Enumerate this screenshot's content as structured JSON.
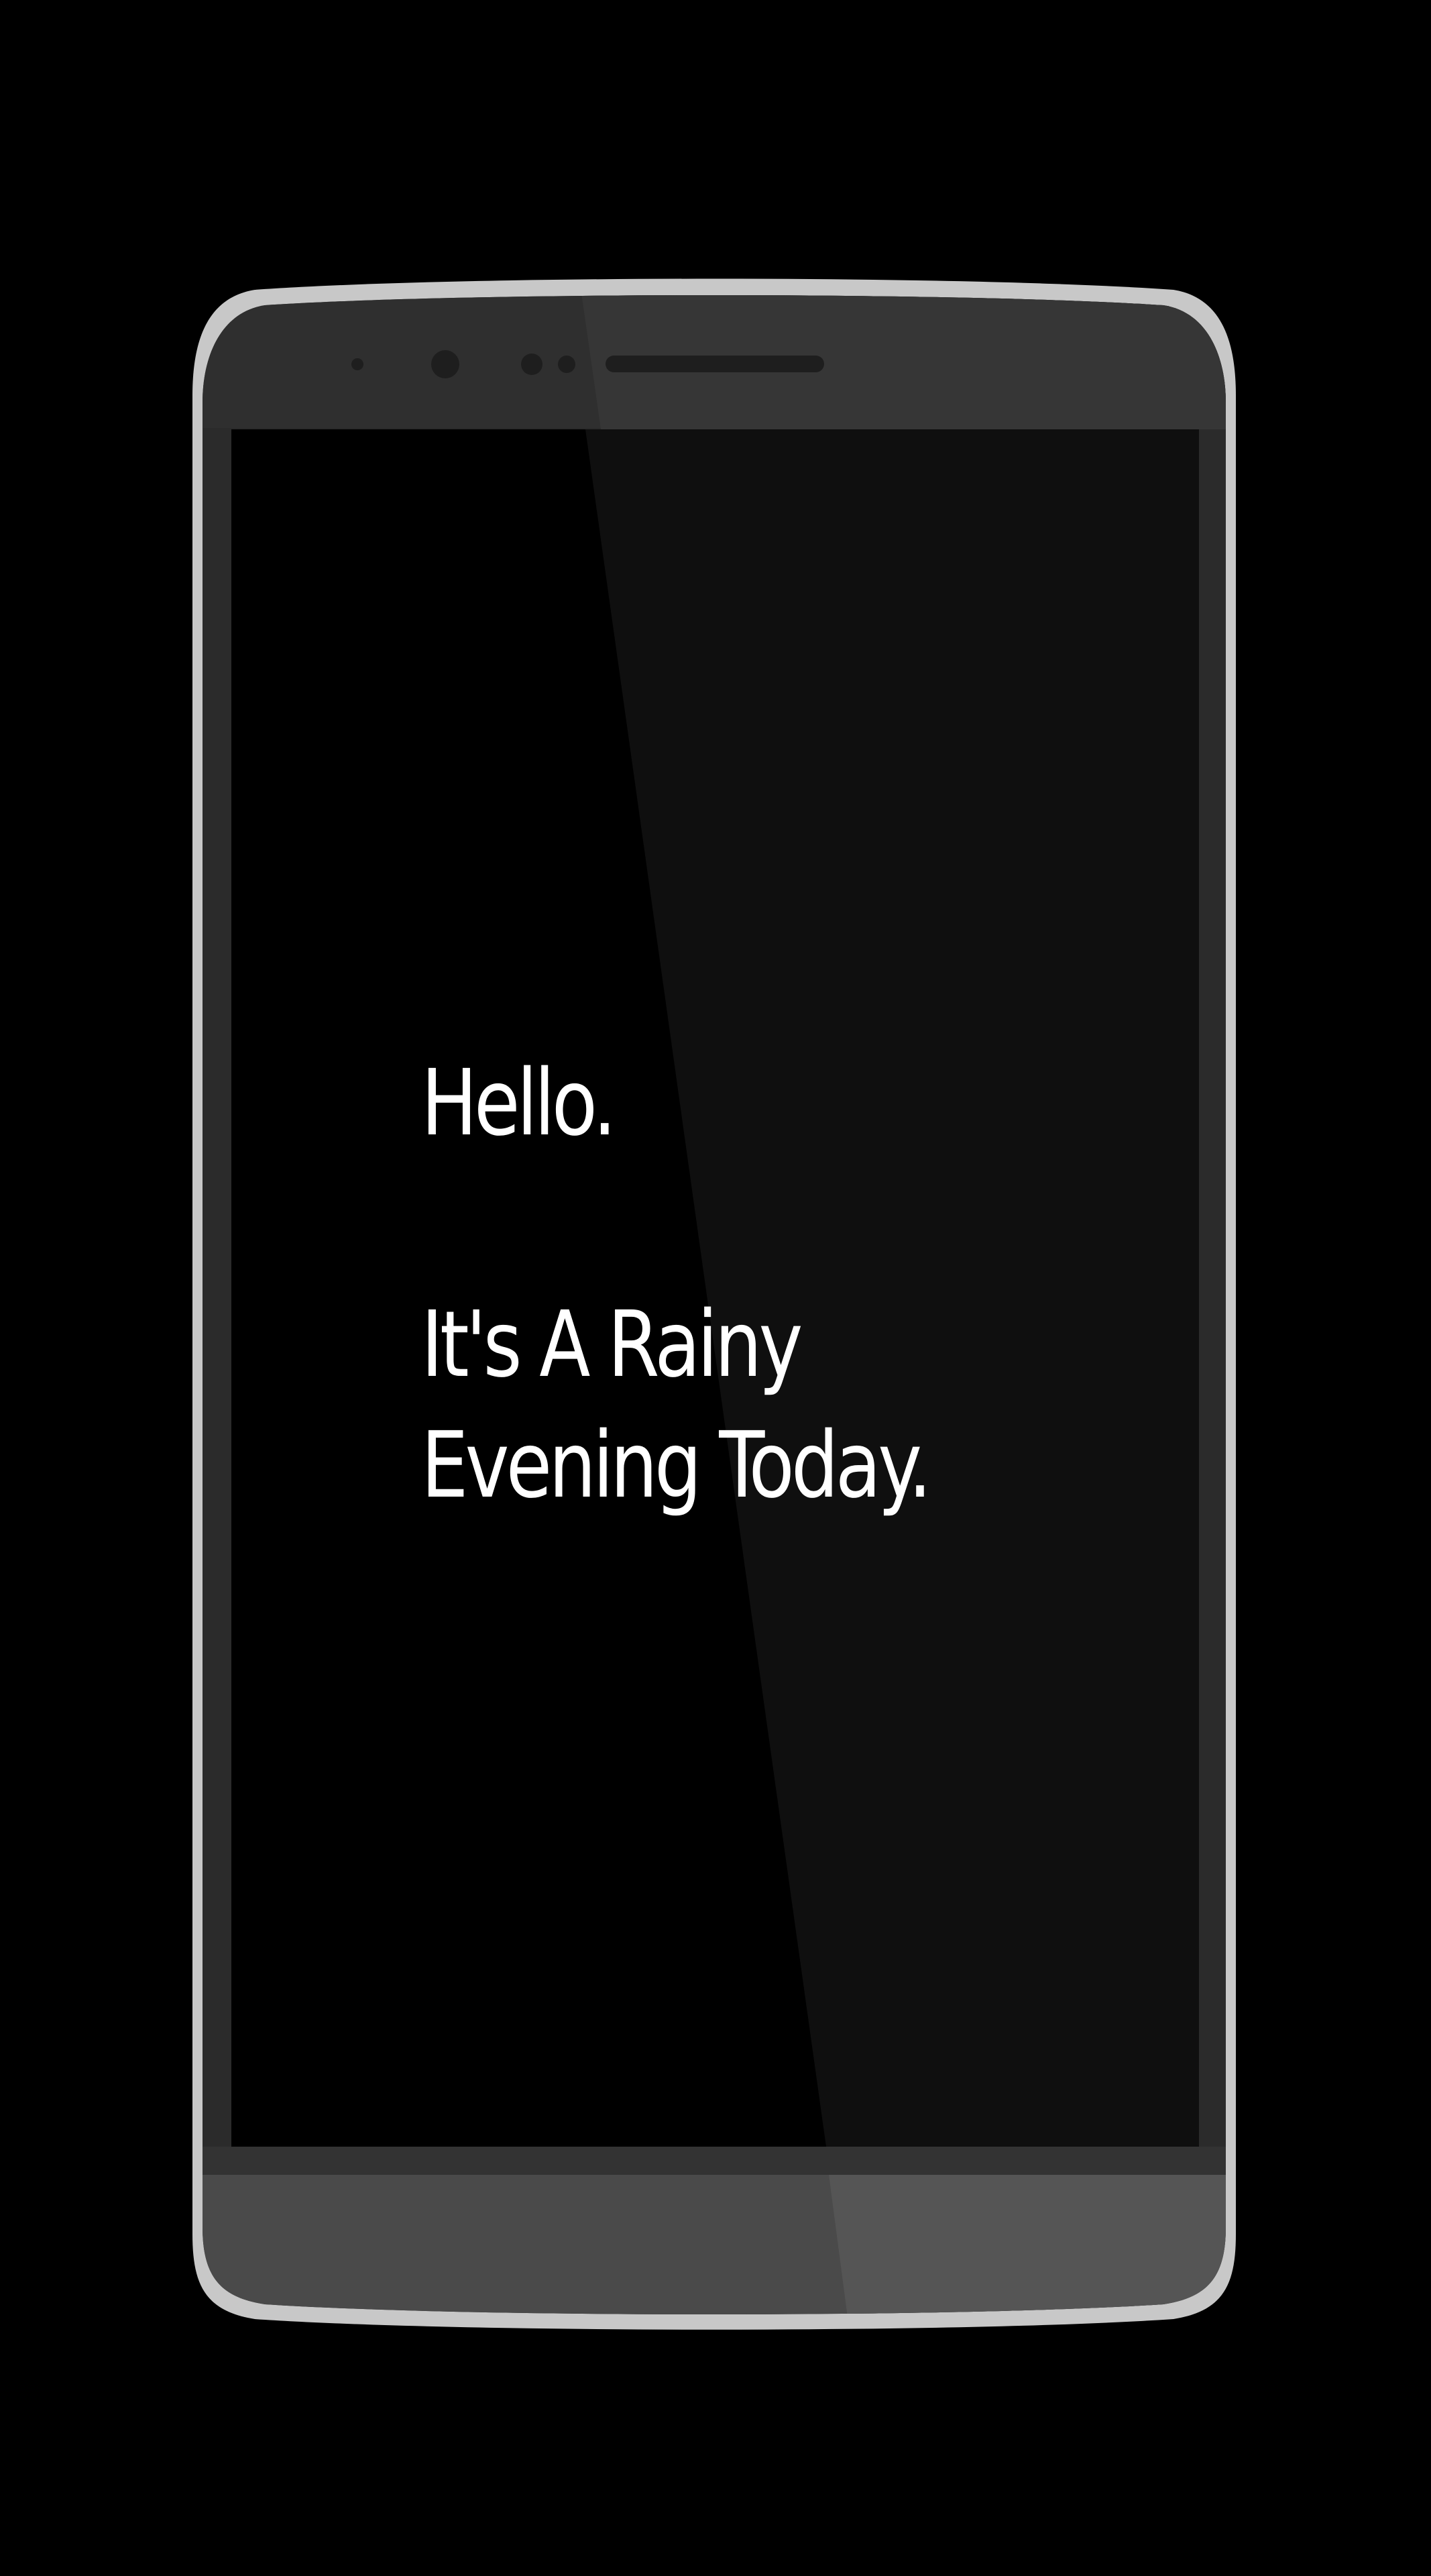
{
  "device": {
    "frame_color": "#c8c8c8",
    "bezel_color": "#2b2b2b",
    "top_bezel_color": "#333333",
    "bottom_bezel_color": "#4a4a4a",
    "screen_color": "#000000",
    "glare_color": "#0f0f0f"
  },
  "screen": {
    "greeting": "Hello.",
    "message_line1": "It's A Rainy",
    "message_line2": "Evening Today.",
    "text_color": "#ffffff"
  }
}
